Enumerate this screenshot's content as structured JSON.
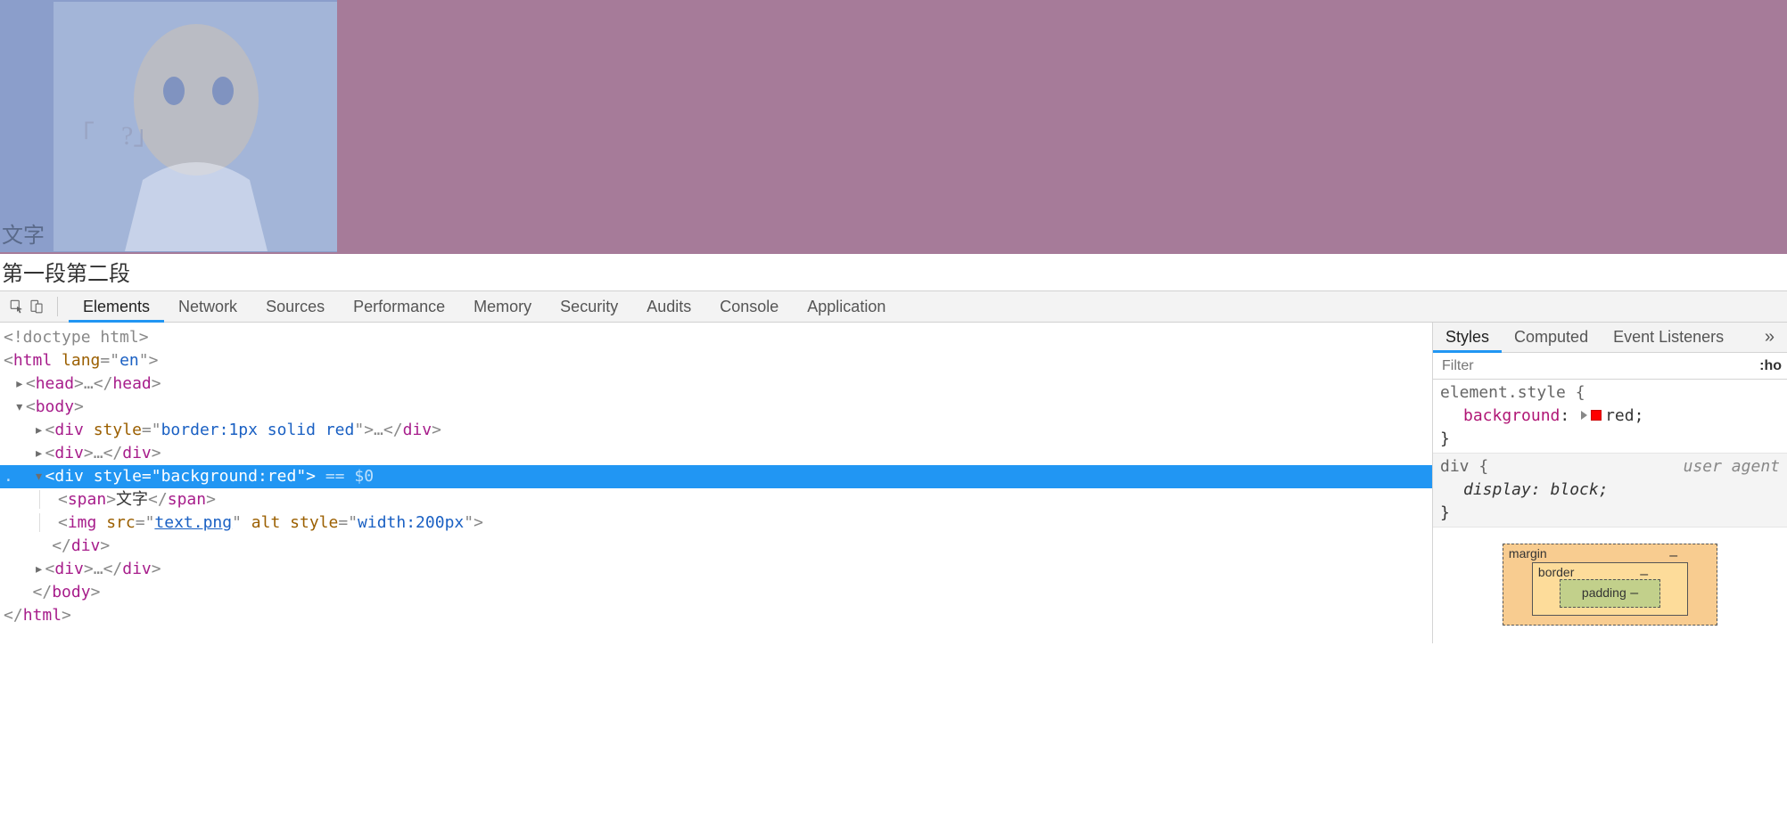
{
  "page": {
    "overlay_text": "文字",
    "second_line": "第一段第二段"
  },
  "devtools_tabs": {
    "elements": "Elements",
    "network": "Network",
    "sources": "Sources",
    "performance": "Performance",
    "memory": "Memory",
    "security": "Security",
    "audits": "Audits",
    "console": "Console",
    "application": "Application"
  },
  "dom": {
    "doctype": "<!doctype html>",
    "html_open_tag": "html",
    "html_attr_name": "lang",
    "html_attr_val": "en",
    "head_tag": "head",
    "body_tag": "body",
    "div_tag": "div",
    "span_tag": "span",
    "img_tag": "img",
    "div1_style_attr": "style",
    "div1_style_val": "border:1px solid red",
    "sel_style_val": "background:red",
    "span_text": "文字",
    "img_src_attr": "src",
    "img_src_val": "text.png",
    "img_alt_attr": "alt",
    "img_style_val": "width:200px",
    "console_ref": "== $0",
    "ellipsis": "…"
  },
  "styles_panel": {
    "tabs": {
      "styles": "Styles",
      "computed": "Computed",
      "listeners": "Event Listeners"
    },
    "more": "»",
    "filter_placeholder": "Filter",
    "hov": ":ho",
    "rule1_selector": "element.style {",
    "rule1_prop": "background",
    "rule1_val": "red",
    "rule1_close": "}",
    "rule2_origin": "user agent",
    "rule2_selector": "div {",
    "rule2_prop": "display",
    "rule2_val": "block",
    "rule2_close": "}"
  },
  "boxmodel": {
    "margin": "margin",
    "border": "border",
    "padding": "padding",
    "dash": "–"
  }
}
